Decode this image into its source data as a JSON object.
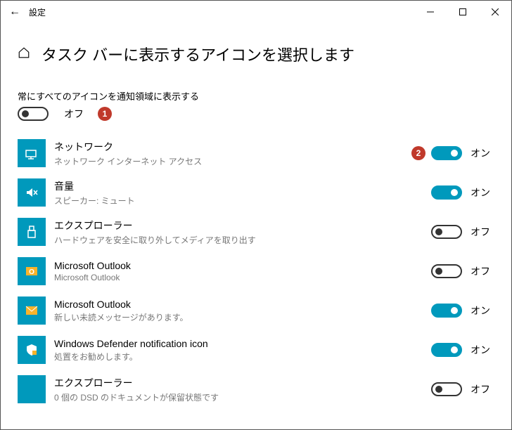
{
  "window": {
    "title": "設定"
  },
  "page": {
    "title": "タスク バーに表示するアイコンを選択します",
    "subtitle": "常にすべてのアイコンを通知領域に表示する"
  },
  "masterToggle": {
    "state": "off",
    "label": "オフ"
  },
  "labels": {
    "on": "オン",
    "off": "オフ"
  },
  "annotations": {
    "1": "1",
    "2": "2"
  },
  "items": [
    {
      "title": "ネットワーク",
      "sub": "ネットワーク インターネット アクセス",
      "on": true,
      "annot": "2",
      "icon": "network"
    },
    {
      "title": "音量",
      "sub": "スピーカー: ミュート",
      "on": true,
      "icon": "volume-mute"
    },
    {
      "title": "エクスプローラー",
      "sub": "ハードウェアを安全に取り外してメディアを取り出す",
      "on": false,
      "icon": "usb"
    },
    {
      "title": "Microsoft Outlook",
      "sub": "Microsoft Outlook",
      "on": false,
      "icon": "outlook"
    },
    {
      "title": "Microsoft Outlook",
      "sub": "新しい未読メッセージがあります。",
      "on": true,
      "icon": "mail"
    },
    {
      "title": "Windows Defender notification icon",
      "sub": "処置をお勧めします。",
      "on": true,
      "icon": "defender"
    },
    {
      "title": "エクスプローラー",
      "sub": "0 個の DSD のドキュメントが保留状態です",
      "on": false,
      "icon": "blank"
    }
  ]
}
